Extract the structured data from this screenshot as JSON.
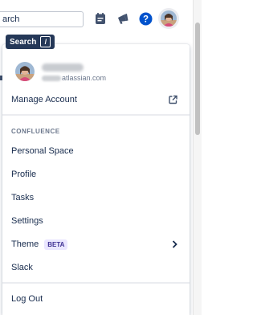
{
  "topbar": {
    "search_text": "arch",
    "icons": {
      "notes": "notes-icon",
      "notifications": "megaphone-icon",
      "help": "help-icon"
    },
    "help_color": "#0052cc"
  },
  "tooltip": {
    "label": "Search",
    "shortcut": "/"
  },
  "menu": {
    "account": {
      "email_domain": "atlassian.com"
    },
    "manage_account": "Manage Account",
    "confluence_heading": "CONFLUENCE",
    "items": [
      {
        "label": "Personal Space"
      },
      {
        "label": "Profile"
      },
      {
        "label": "Tasks"
      },
      {
        "label": "Settings"
      },
      {
        "label": "Theme",
        "badge": "BETA"
      },
      {
        "label": "Slack"
      }
    ],
    "log_out": "Log Out"
  },
  "colors": {
    "text": "#172b4d",
    "muted": "#6b778c",
    "beta_bg": "#eae6ff",
    "beta_text": "#403294",
    "tooltip_bg": "#253858"
  }
}
